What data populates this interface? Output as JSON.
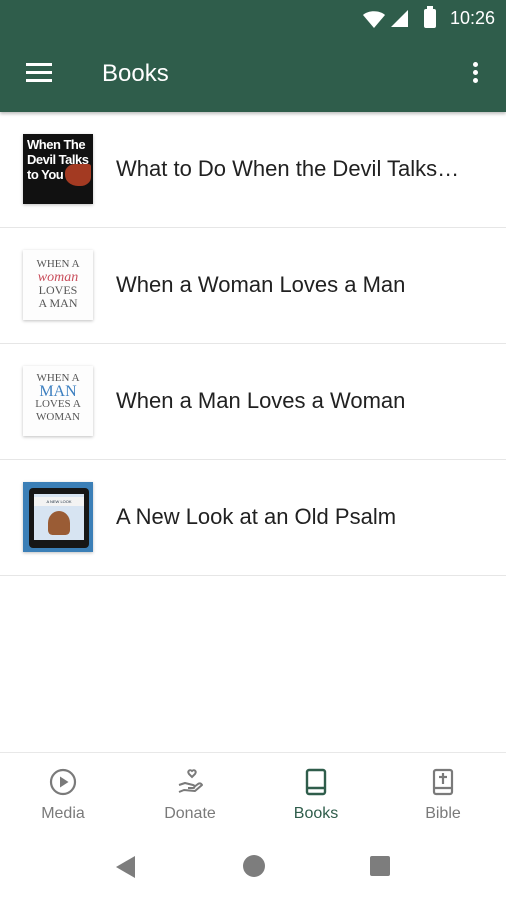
{
  "status_bar": {
    "time": "10:26"
  },
  "app_bar": {
    "title": "Books",
    "menu_icon": "hamburger-menu-icon",
    "overflow_icon": "more-vertical-icon"
  },
  "books": [
    {
      "title": "What to Do When the Devil Talks…",
      "cover_text": [
        "When The",
        "Devil Talks",
        "to You"
      ]
    },
    {
      "title": "When a Woman Loves a Man",
      "cover_text": [
        "WHEN A",
        "woman",
        "LOVES",
        "A MAN"
      ]
    },
    {
      "title": "When a Man Loves a Woman",
      "cover_text": [
        "WHEN A",
        "MAN",
        "LOVES A",
        "WOMAN"
      ]
    },
    {
      "title": "A New Look at an Old Psalm",
      "cover_text": [
        "A NEW LOOK",
        "at an OLD PSALM"
      ]
    }
  ],
  "bottom_nav": {
    "active": "Books",
    "tabs": [
      {
        "label": "Media",
        "icon": "play-circle-icon"
      },
      {
        "label": "Donate",
        "icon": "donate-hand-heart-icon"
      },
      {
        "label": "Books",
        "icon": "book-icon"
      },
      {
        "label": "Bible",
        "icon": "bible-cross-icon"
      }
    ]
  },
  "colors": {
    "primary": "#2f5d4b",
    "text": "#212121",
    "inactive": "#7a7a7a"
  }
}
